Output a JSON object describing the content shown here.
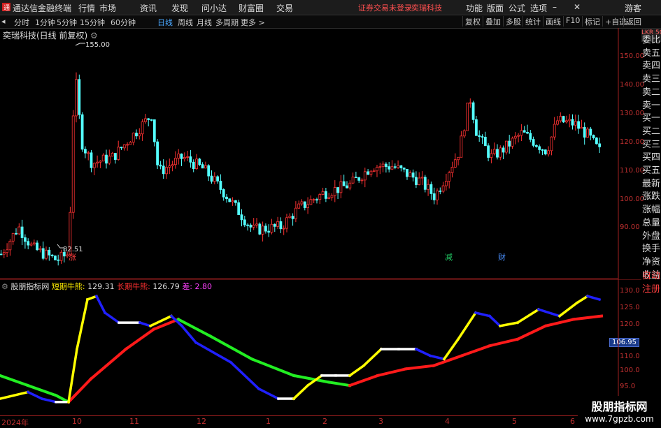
{
  "menubar": {
    "app_title": "通达信金融终端",
    "menus": [
      "行情",
      "市场",
      "资讯",
      "发现",
      "问小达",
      "财富圈",
      "交易"
    ],
    "notice": "证券交易未登录",
    "stock_name": "奕瑞科技",
    "right_menus": [
      "功能",
      "版面",
      "公式",
      "选项"
    ],
    "user": "游客"
  },
  "toolbar": {
    "periods": [
      "分时",
      "1分钟",
      "5分钟",
      "15分钟",
      "60分钟",
      "日线",
      "周线",
      "月线",
      "多周期",
      "更多 >"
    ],
    "active_period": "日线",
    "right_buttons": [
      "复权",
      "叠加",
      "多股",
      "统计",
      "画线",
      "F10",
      "标记",
      "+自选",
      "返回"
    ]
  },
  "chart": {
    "title": "奕瑞科技(日线 前复权)",
    "high_label": "155.00",
    "low_label": "82.51",
    "price_axis": [
      "150.00",
      "140.00",
      "130.00",
      "120.00",
      "110.00",
      "100.00",
      "90.00"
    ],
    "markers": [
      {
        "text": "涨",
        "color": "#ff4040"
      },
      {
        "text": "减",
        "color": "#22cc66"
      },
      {
        "text": "财",
        "color": "#4a90ff"
      }
    ]
  },
  "side_panel": {
    "logo": "LKR 500",
    "items": [
      "委比",
      "卖五",
      "卖四",
      "卖三",
      "卖二",
      "卖一",
      "买一",
      "买二",
      "买三",
      "买四",
      "买五",
      "最新",
      "涨跌",
      "涨幅",
      "总量",
      "外盘",
      "换手",
      "净资",
      "收益"
    ],
    "bottom_items": [
      "自动",
      "注册"
    ]
  },
  "indicator": {
    "name": "股朋指标网",
    "short_label": "短期牛熊:",
    "short_value": "129.31",
    "long_label": "长期牛熊:",
    "long_value": "126.79",
    "diff_label": "差:",
    "diff_value": "2.80",
    "axis": [
      "130.0",
      "125.0",
      "120.0",
      "115.0",
      "110.0",
      "105.0",
      "100.0",
      "95.0"
    ],
    "current_value": "106.95"
  },
  "x_axis": {
    "labels": [
      "2024年",
      "10",
      "11",
      "12",
      "1",
      "2",
      "3",
      "4",
      "5",
      "6"
    ]
  },
  "watermark": {
    "line1": "股朋指标网",
    "line2": "www.7gpzb.com"
  },
  "chart_data": {
    "type": "line",
    "title": "奕瑞科技(日线 前复权)",
    "xlabel": "",
    "ylabel": "",
    "ylim": [
      82,
      158
    ],
    "x": [
      "2024-09",
      "2024-10",
      "2024-11",
      "2024-12",
      "2025-01",
      "2025-02",
      "2025-03",
      "2025-04",
      "2025-05",
      "2025-06"
    ],
    "series": [
      {
        "name": "Close",
        "values": [
          90,
          148,
          122,
          117,
          96,
          110,
          115,
          110,
          128,
          129
        ]
      }
    ],
    "indicator_series": [
      {
        "name": "短期牛熊",
        "values": [
          97,
          128,
          120,
          119,
          97,
          103,
          113,
          111,
          127,
          130
        ]
      },
      {
        "name": "长期牛熊",
        "values": [
          103,
          97,
          109,
          121,
          105,
          101,
          108,
          113,
          120,
          127
        ]
      }
    ]
  }
}
